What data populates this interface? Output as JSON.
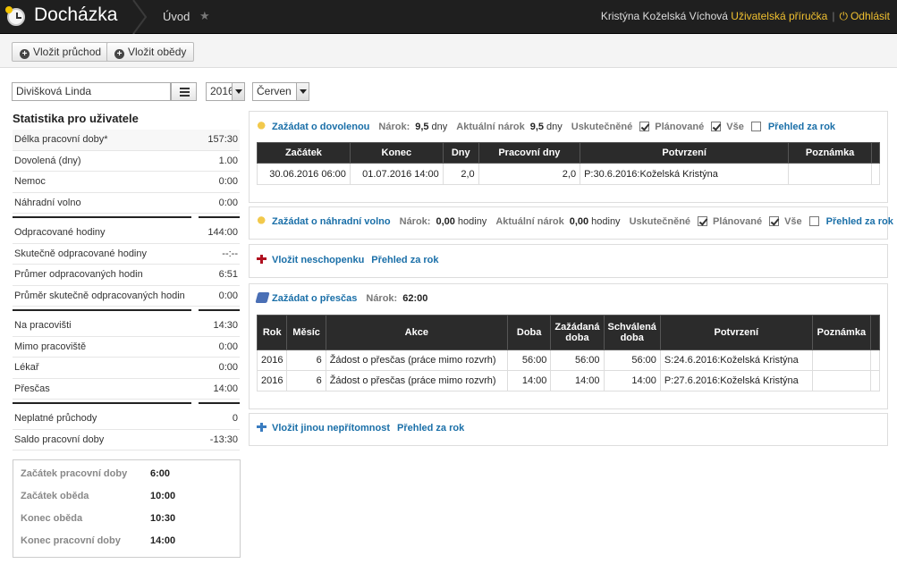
{
  "header": {
    "app_title": "Docházka",
    "nav_item": "Úvod",
    "user_name": "Kristýna Koželská Víchová",
    "manual_link": "Uživatelská příručka",
    "logout_link": "Odhlásit"
  },
  "toolbar": {
    "add_passage": "Vložit průchod",
    "add_lunch": "Vložit obědy"
  },
  "filters": {
    "employee": "Divišková Linda",
    "year": "2016",
    "month": "Červen"
  },
  "stats": {
    "title": "Statistika pro uživatele",
    "group1": [
      {
        "label": "Délka pracovní doby*",
        "value": "157:30"
      },
      {
        "label": "Dovolená (dny)",
        "value": "1.00"
      },
      {
        "label": "Nemoc",
        "value": "0:00"
      },
      {
        "label": "Náhradní volno",
        "value": "0:00"
      }
    ],
    "group2": [
      {
        "label": "Odpracované hodiny",
        "value": "144:00"
      },
      {
        "label": "Skutečně odpracované hodiny",
        "value": "--:--"
      },
      {
        "label": "Průmer odpracovaných hodin",
        "value": "6:51"
      },
      {
        "label": "Průměr skutečně odpracovaných hodin",
        "value": "0:00"
      }
    ],
    "group3": [
      {
        "label": "Na pracovišti",
        "value": "14:30"
      },
      {
        "label": "Mimo pracoviště",
        "value": "0:00"
      },
      {
        "label": "Lékař",
        "value": "0:00"
      },
      {
        "label": "Přesčas",
        "value": "14:00"
      }
    ],
    "group4": [
      {
        "label": "Neplatné průchody",
        "value": "0"
      },
      {
        "label": "Saldo pracovní doby",
        "value": "-13:30"
      }
    ]
  },
  "times": [
    {
      "label": "Začátek pracovní doby",
      "value": "6:00"
    },
    {
      "label": "Začátek oběda",
      "value": "10:00"
    },
    {
      "label": "Konec oběda",
      "value": "10:30"
    },
    {
      "label": "Konec pracovní doby",
      "value": "14:00"
    }
  ],
  "vacation": {
    "title": "Zažádat o dovolenou",
    "claim_label": "Nárok:",
    "claim_value": "9,5",
    "claim_unit": "dny",
    "current_label": "Aktuální nárok",
    "current_value": "9,5",
    "current_unit": "dny",
    "done_label": "Uskutečněné",
    "planned_label": "Plánované",
    "all_label": "Vše",
    "year_link": "Přehled za rok",
    "columns": [
      "Začátek",
      "Konec",
      "Dny",
      "Pracovní dny",
      "Potvrzení",
      "Poznámka"
    ],
    "rows": [
      [
        "30.06.2016 06:00",
        "01.07.2016 14:00",
        "2,0",
        "2,0",
        "P:30.6.2016:Koželská Kristýna",
        ""
      ]
    ]
  },
  "comp_leave": {
    "title": "Zažádat o náhradní volno",
    "claim_label": "Nárok:",
    "claim_value": "0,00",
    "claim_unit": "hodiny",
    "current_label": "Aktuální nárok",
    "current_value": "0,00",
    "current_unit": "hodiny",
    "done_label": "Uskutečněné",
    "planned_label": "Plánované",
    "all_label": "Vše",
    "year_link": "Přehled za rok"
  },
  "sick": {
    "title": "Vložit neschopenku",
    "year_link": "Přehled za rok"
  },
  "overtime": {
    "title": "Zažádat o přesčas",
    "claim_label": "Nárok:",
    "claim_value": "62:00",
    "columns": [
      "Rok",
      "Měsíc",
      "Akce",
      "Doba",
      "Zažádaná doba",
      "Schválená doba",
      "Potvrzení",
      "Poznámka"
    ],
    "rows": [
      [
        "2016",
        "6",
        "Žádost o přesčas (práce mimo rozvrh)",
        "56:00",
        "56:00",
        "56:00",
        "S:24.6.2016:Koželská Kristýna",
        ""
      ],
      [
        "2016",
        "6",
        "Žádost o přesčas (práce mimo rozvrh)",
        "14:00",
        "14:00",
        "14:00",
        "P:27.6.2016:Koželská Kristýna",
        ""
      ]
    ]
  },
  "other": {
    "title": "Vložit jinou nepřítomnost",
    "year_link": "Přehled za rok"
  }
}
